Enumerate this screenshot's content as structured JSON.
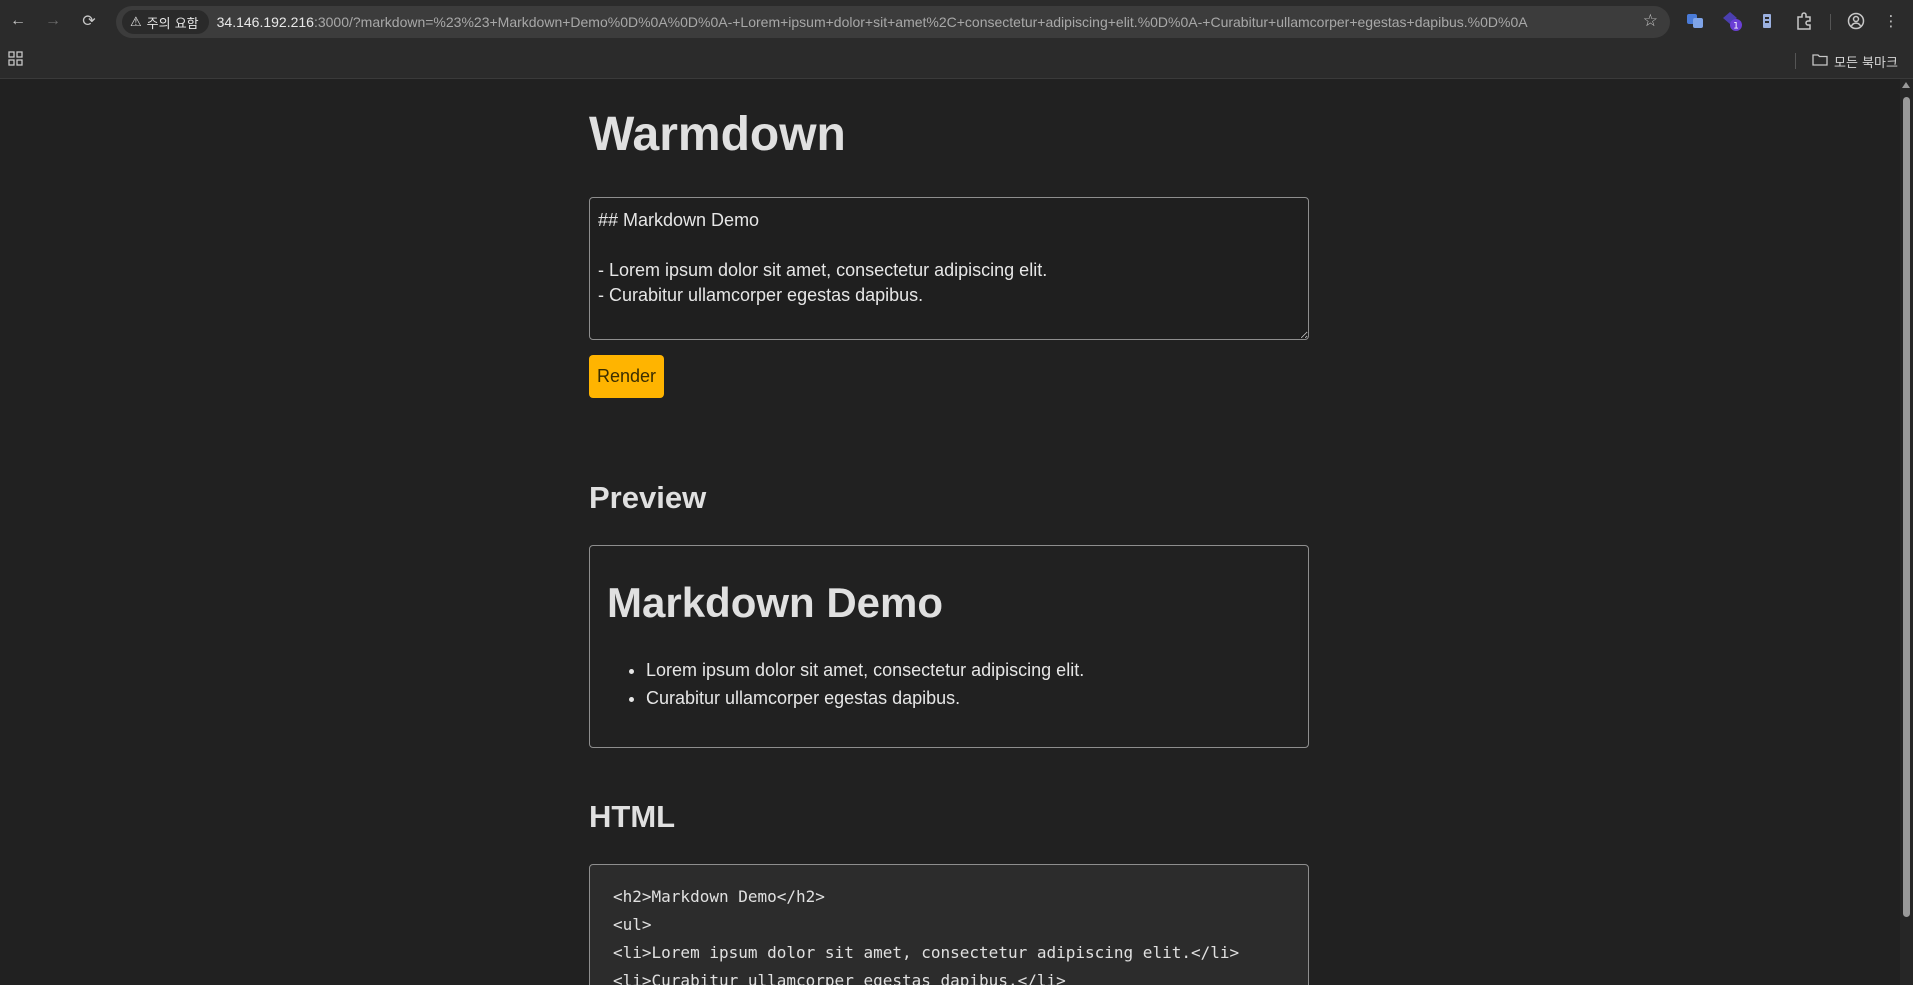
{
  "browser": {
    "security_label": "주의 요함",
    "url_host": "34.146.192.216",
    "url_rest": ":3000/?markdown=%23%23+Markdown+Demo%0D%0A%0D%0A-+Lorem+ipsum+dolor+sit+amet%2C+consectetur+adipiscing+elit.%0D%0A-+Curabitur+ullamcorper+egestas+dapibus.%0D%0A",
    "all_bookmarks_label": "모든 북마크",
    "extension_badge": "1"
  },
  "app": {
    "title": "Warmdown",
    "editor_value": "## Markdown Demo\n\n- Lorem ipsum dolor sit amet, consectetur adipiscing elit.\n- Curabitur ullamcorper egestas dapibus.",
    "render_label": "Render"
  },
  "preview": {
    "heading": "Preview",
    "rendered_title": "Markdown Demo",
    "items": [
      "Lorem ipsum dolor sit amet, consectetur adipiscing elit.",
      "Curabitur ullamcorper egestas dapibus."
    ]
  },
  "html_section": {
    "heading": "HTML",
    "code_lines": [
      "<h2>Markdown Demo</h2>",
      "<ul>",
      "<li>Lorem ipsum dolor sit amet, consectetur adipiscing elit.</li>",
      "<li>Curabitur ullamcorper egestas dapibus.</li>"
    ]
  }
}
